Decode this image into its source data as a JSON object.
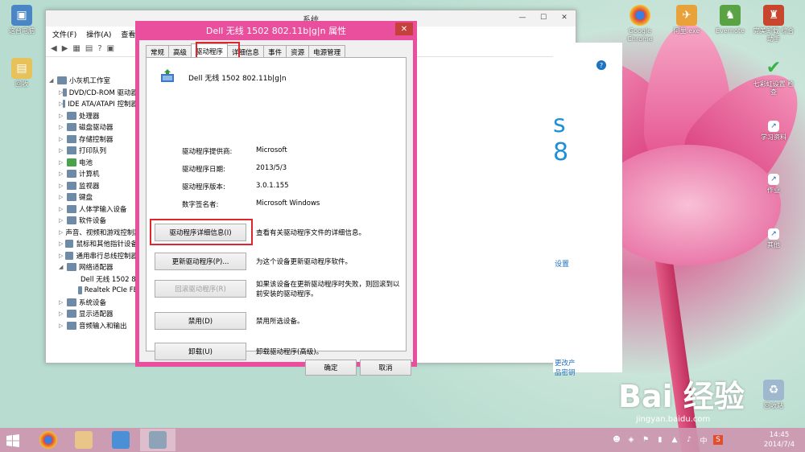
{
  "desktop": {
    "icons_left": [
      {
        "label": "这台电脑"
      },
      {
        "label": "回收"
      }
    ],
    "icons_right": [
      {
        "label": "Google Chrome"
      },
      {
        "label": "阿里.exe"
      },
      {
        "label": "Evernote"
      },
      {
        "label": "完美卸载 综合助手"
      },
      {
        "label": "七彩虹设置 检查"
      },
      {
        "label": "学习资料"
      },
      {
        "label": "作业"
      },
      {
        "label": "其他"
      },
      {
        "label": "回收站"
      }
    ]
  },
  "device_manager": {
    "title": "系统",
    "menu": [
      "文件(F)",
      "操作(A)",
      "查看(V)"
    ],
    "tree": [
      {
        "label": "小灰机工作室",
        "level": 0
      },
      {
        "label": "DVD/CD-ROM 驱动器",
        "level": 1
      },
      {
        "label": "IDE ATA/ATAPI 控制器",
        "level": 1
      },
      {
        "label": "处理器",
        "level": 1
      },
      {
        "label": "磁盘驱动器",
        "level": 1
      },
      {
        "label": "存储控制器",
        "level": 1
      },
      {
        "label": "打印队列",
        "level": 1
      },
      {
        "label": "电池",
        "level": 1
      },
      {
        "label": "计算机",
        "level": 1
      },
      {
        "label": "监视器",
        "level": 1
      },
      {
        "label": "键盘",
        "level": 1
      },
      {
        "label": "人体学输入设备",
        "level": 1
      },
      {
        "label": "软件设备",
        "level": 1
      },
      {
        "label": "声音、视频和游戏控制器",
        "level": 1
      },
      {
        "label": "鼠标和其他指针设备",
        "level": 1
      },
      {
        "label": "通用串行总线控制器",
        "level": 1
      },
      {
        "label": "网络适配器",
        "level": 1
      },
      {
        "label": "Dell 无线 1502 802.11b|g|n",
        "level": 2
      },
      {
        "label": "Realtek PCIe FE",
        "level": 2
      },
      {
        "label": "系统设备",
        "level": 1
      },
      {
        "label": "显示适配器",
        "level": 1
      },
      {
        "label": "音频输入和输出",
        "level": 1
      }
    ],
    "system_panel": {
      "brand": "s 8",
      "link_settings": "设置",
      "link_product_key": "更改产品密钥"
    }
  },
  "dialog": {
    "title": "Dell 无线 1502 802.11b|g|n 属性",
    "close": "✕",
    "tabs": [
      "常规",
      "高级",
      "驱动程序",
      "详细信息",
      "事件",
      "资源",
      "电源管理"
    ],
    "active_tab": "驱动程序",
    "device_name": "Dell 无线 1502 802.11b|g|n",
    "info": [
      {
        "key": "驱动程序提供商:",
        "value": "Microsoft"
      },
      {
        "key": "驱动程序日期:",
        "value": "2013/5/3"
      },
      {
        "key": "驱动程序版本:",
        "value": "3.0.1.155"
      },
      {
        "key": "数字签名者:",
        "value": "Microsoft Windows"
      }
    ],
    "actions": [
      {
        "label": "驱动程序详细信息(I)",
        "desc": "查看有关驱动程序文件的详细信息。",
        "enabled": true
      },
      {
        "label": "更新驱动程序(P)...",
        "desc": "为这个设备更新驱动程序软件。",
        "enabled": true
      },
      {
        "label": "回滚驱动程序(R)",
        "desc": "如果该设备在更新驱动程序时失败，则回滚到以前安装的驱动程序。",
        "enabled": false
      },
      {
        "label": "禁用(D)",
        "desc": "禁用所选设备。",
        "enabled": true
      },
      {
        "label": "卸载(U)",
        "desc": "卸载驱动程序(高级)。",
        "enabled": true
      }
    ],
    "ok": "确定",
    "cancel": "取消"
  },
  "taskbar": {
    "clock_time": "14:45",
    "clock_date": "2014/7/4",
    "tray_ime": "中"
  },
  "watermark": {
    "text": "Bai 经验",
    "sub": "jingyan.baidu.com"
  }
}
